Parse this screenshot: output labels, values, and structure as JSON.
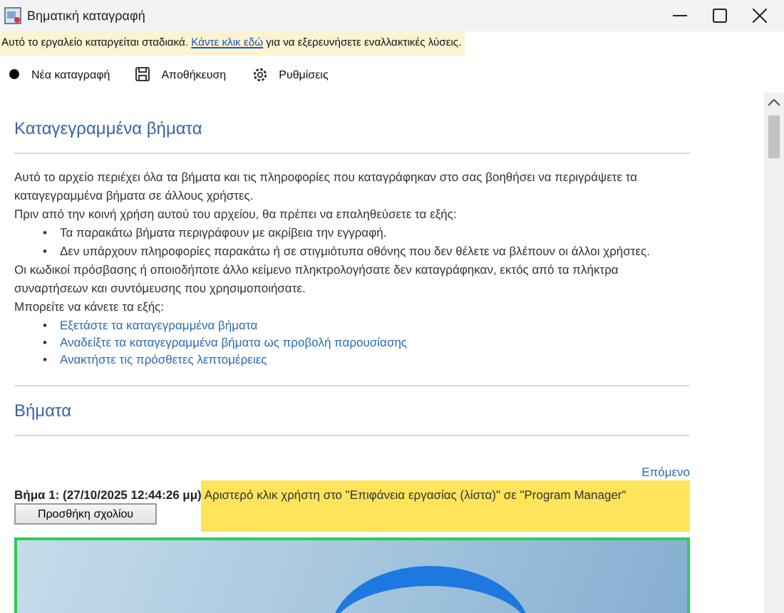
{
  "window": {
    "title": "Βηματική καταγραφή"
  },
  "notice": {
    "before": "Αυτό το εργαλείο καταργείται σταδιακά. ",
    "link": "Κάντε κλικ εδώ",
    "after": " για να εξερευνήσετε εναλλακτικές λύσεις."
  },
  "toolbar": [
    {
      "kind": "record",
      "label": "Νέα καταγραφή"
    },
    {
      "kind": "save",
      "label": "Αποθήκευση"
    },
    {
      "kind": "settings",
      "label": "Ρυθμίσεις"
    }
  ],
  "recorded": {
    "heading": "Καταγεγραμμένα βήματα",
    "intro": "Αυτό το αρχείο περιέχει όλα τα βήματα και τις πληροφορίες που καταγράφηκαν στο σας βοηθήσει να περιγράψετε τα καταγεγραμμένα βήματα σε άλλους χρήστες.",
    "before_sharing": "Πριν από την κοινή χρήση αυτού του αρχείου, θα πρέπει να επαληθεύσετε τα εξής:",
    "checks": [
      {
        "marker": "•",
        "text": "Τα παρακάτω βήματα περιγράφουν με ακρίβεια την εγγραφή."
      },
      {
        "marker": "•",
        "text": "Δεν υπάρχουν πληροφορίες παρακάτω ή σε στιγμιότυπα οθόνης που δεν θέλετε να βλέπουν οι άλλοι χρήστες."
      }
    ],
    "passwords": "Οι κωδικοί πρόσβασης ή οποιοδήποτε άλλο κείμενο πληκτρολογήσατε δεν καταγράφηκαν, εκτός από τα πλήκτρα συναρτήσεων και συντόμευσης που χρησιμοποιήσατε.",
    "you_can": "Μπορείτε να κάνετε τα εξής:",
    "links": [
      {
        "marker": "•",
        "text": "Εξετάστε τα καταγεγραμμένα βήματα"
      },
      {
        "marker": "•",
        "text": "Αναδείξτε τα καταγεγραμμένα βήματα ως προβολή παρουσίασης"
      },
      {
        "marker": "•",
        "text": "Ανακτήστε τις πρόσθετες λεπτομέρειες"
      }
    ]
  },
  "steps": {
    "heading": "Βήματα",
    "next_link": "Επόμενο",
    "step_title": "Βήμα 1: (27/10/2025 12:44:26 μμ)",
    "description": "Αριστερό κλικ χρήστη στο \"Επιφάνεια εργασίας (λίστα)\" σε \"Program Manager\"",
    "comment_button": "Προσθήκη σχολίου"
  }
}
